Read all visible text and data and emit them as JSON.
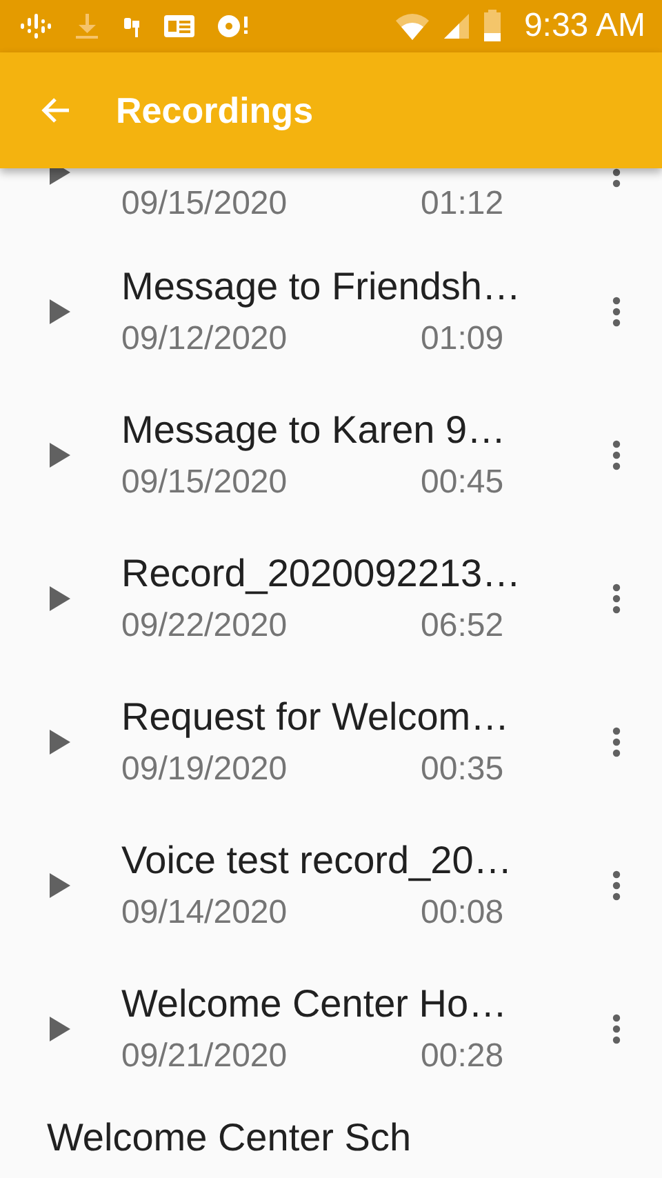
{
  "status_bar": {
    "time": "9:33 AM"
  },
  "app_bar": {
    "title": "Recordings"
  },
  "recordings": [
    {
      "date": "09/15/2020",
      "duration": "01:12"
    },
    {
      "title": "Message to Friendsh…",
      "date": "09/12/2020",
      "duration": "01:09"
    },
    {
      "title": "Message to Karen 9…",
      "date": "09/15/2020",
      "duration": "00:45"
    },
    {
      "title": "Record_2020092213…",
      "date": "09/22/2020",
      "duration": "06:52"
    },
    {
      "title": "Request for Welcom…",
      "date": "09/19/2020",
      "duration": "00:35"
    },
    {
      "title": "Voice test record_20…",
      "date": "09/14/2020",
      "duration": "00:08"
    },
    {
      "title": "Welcome Center Ho…",
      "date": "09/21/2020",
      "duration": "00:28"
    },
    {
      "title": "Welcome Center Sch"
    }
  ]
}
